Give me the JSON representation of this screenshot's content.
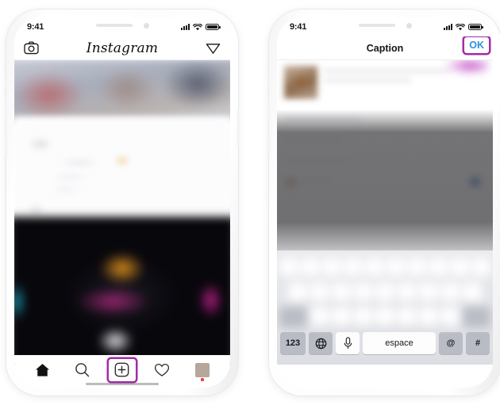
{
  "phones": [
    {
      "id": "instagram-feed",
      "status_bar": {
        "time": "9:41",
        "signal_icon": "cellular-signal-icon",
        "wifi_icon": "wifi-icon",
        "battery_icon": "battery-icon"
      },
      "header": {
        "camera_icon": "camera-icon",
        "logo": "Instagram",
        "send_icon": "paper-plane-icon"
      },
      "tabbar": {
        "items": [
          {
            "name": "home",
            "icon": "home-icon",
            "highlighted": false
          },
          {
            "name": "search",
            "icon": "search-icon",
            "highlighted": false
          },
          {
            "name": "new-post",
            "icon": "plus-square-icon",
            "highlighted": true
          },
          {
            "name": "activity",
            "icon": "heart-icon",
            "highlighted": false
          },
          {
            "name": "profile",
            "icon": "avatar-icon",
            "highlighted": false
          }
        ],
        "annotation_arrow": "left-pointing-arrow"
      }
    },
    {
      "id": "caption-screen",
      "status_bar": {
        "time": "9:41",
        "signal_icon": "cellular-signal-icon",
        "wifi_icon": "wifi-icon",
        "battery_icon": "battery-icon"
      },
      "header": {
        "title": "Caption",
        "ok_label": "OK",
        "ok_highlighted": true
      },
      "keyboard": {
        "bottom_row": [
          {
            "name": "numbers-key",
            "label": "123",
            "icon": null
          },
          {
            "name": "globe-key",
            "label": "",
            "icon": "globe-icon"
          },
          {
            "name": "dictation-key",
            "label": "",
            "icon": "microphone-icon"
          },
          {
            "name": "space-key",
            "label": "espace",
            "icon": null
          },
          {
            "name": "at-key",
            "label": "@",
            "icon": null
          },
          {
            "name": "hash-key",
            "label": "#",
            "icon": null
          }
        ]
      }
    }
  ],
  "colors": {
    "highlight_purple": "#a32ba8",
    "ok_blue": "#2f8fe0",
    "notification_red": "#e8453c",
    "keyboard_gray": "#b9bcc4"
  }
}
